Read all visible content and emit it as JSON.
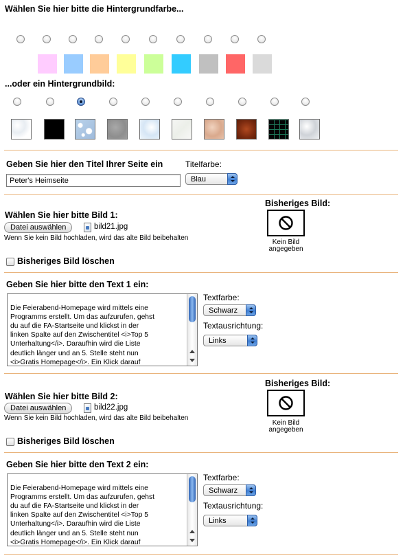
{
  "background_color": {
    "heading": "Wählen Sie hier bitte die Hintergrundfarbe...",
    "options": [
      {
        "color": "#ffffff",
        "selected": false
      },
      {
        "color": "#ffccff",
        "selected": false
      },
      {
        "color": "#99ccff",
        "selected": false
      },
      {
        "color": "#ffcc99",
        "selected": false
      },
      {
        "color": "#ffff99",
        "selected": false
      },
      {
        "color": "#ccff99",
        "selected": false
      },
      {
        "color": "#33ccff",
        "selected": false
      },
      {
        "color": "#c0c0c0",
        "selected": false
      },
      {
        "color": "#ff6666",
        "selected": false
      },
      {
        "color": "#dadada",
        "selected": false
      }
    ]
  },
  "background_image": {
    "heading": "...oder ein Hintergrundbild:",
    "options": [
      {
        "pattern": "white-marble",
        "selected": false
      },
      {
        "pattern": "black",
        "selected": false
      },
      {
        "pattern": "blue-bubbles",
        "selected": true
      },
      {
        "pattern": "grey-stone",
        "selected": false
      },
      {
        "pattern": "light-blue-marble",
        "selected": false
      },
      {
        "pattern": "white-paper",
        "selected": false
      },
      {
        "pattern": "beige-marble",
        "selected": false
      },
      {
        "pattern": "brown-texture",
        "selected": false
      },
      {
        "pattern": "black-circuit",
        "selected": false
      },
      {
        "pattern": "grey-marble",
        "selected": false
      }
    ]
  },
  "title_section": {
    "heading": "Geben Sie hier den Titel Ihrer Seite ein",
    "title_value": "Peter's Heimseite",
    "color_label": "Titelfarbe:",
    "color_value": "Blau"
  },
  "image1": {
    "heading": "Wählen Sie hier bitte Bild 1:",
    "button_label": "Datei auswählen",
    "file_name": "bild21.jpg",
    "hint": "Wenn Sie kein Bild hochladen, wird das alte Bild beibehalten",
    "previous_label": "Bisheriges Bild:",
    "no_image_line1": "Kein Bild",
    "no_image_line2": "angegeben",
    "delete_label": "Bisheriges Bild löschen",
    "delete_checked": false
  },
  "text1": {
    "heading": "Geben Sie hier bitte den Text 1 ein:",
    "content": "Die Feierabend-Homepage wird mittels eine\nProgramms erstellt. Um das aufzurufen, gehst\ndu auf die FA-Startseite und klickst in der\nlinken Spalte auf den Zwischentitel <i>Top 5\nUnterhaltung</i>. Daraufhin wird die Liste\ndeutlich länger und an 5. Stelle steht nun\n<i>Gratis Homepage</i>. Ein Klick darauf\nführt Dich zur folgenden Abbildung oder klick",
    "color_label": "Textfarbe:",
    "color_value": "Schwarz",
    "align_label": "Textausrichtung:",
    "align_value": "Links"
  },
  "image2": {
    "heading": "Wählen Sie hier bitte Bild 2:",
    "button_label": "Datei auswählen",
    "file_name": "bild22.jpg",
    "hint": "Wenn Sie kein Bild hochladen, wird das alte Bild beibehalten",
    "previous_label": "Bisheriges Bild:",
    "no_image_line1": "Kein Bild",
    "no_image_line2": "angegeben",
    "delete_label": "Bisheriges Bild löschen",
    "delete_checked": false
  },
  "text2": {
    "heading": "Geben Sie hier bitte den Text 2 ein:",
    "content": "Die Feierabend-Homepage wird mittels eine\nProgramms erstellt. Um das aufzurufen, gehst\ndu auf die FA-Startseite und klickst in der\nlinken Spalte auf den Zwischentitel <i>Top 5\nUnterhaltung</i>. Daraufhin wird die Liste\ndeutlich länger und an 5. Stelle steht nun\n<i>Gratis Homepage</i>. Ein Klick darauf\nführt Dich zur folgenden Abbildung oder klick",
    "color_label": "Textfarbe:",
    "color_value": "Schwarz",
    "align_label": "Textausrichtung:",
    "align_value": "Links"
  },
  "colors": {
    "divider": "#e9b47c",
    "select_accent": "#3f7fd3"
  }
}
